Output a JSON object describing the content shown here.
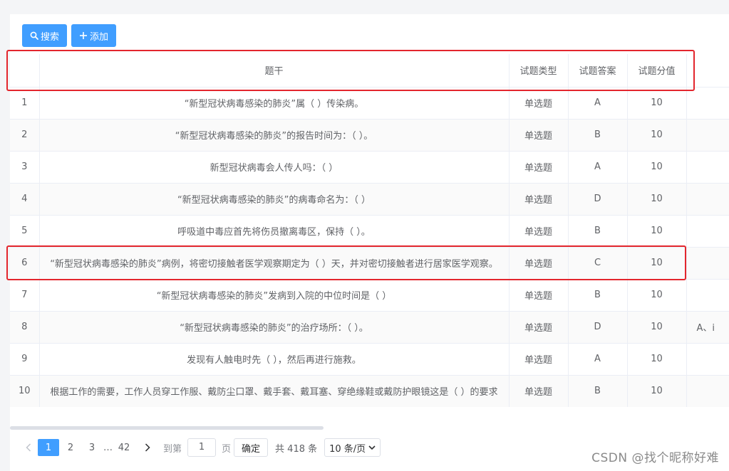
{
  "toolbar": {
    "search_label": "搜索",
    "add_label": "添加",
    "search_icon": "search-icon",
    "add_icon": "plus-icon"
  },
  "table": {
    "columns": [
      "",
      "题干",
      "试题类型",
      "试题答案",
      "试题分值",
      ""
    ],
    "rows": [
      {
        "index": "1",
        "question": "“新型冠状病毒感染的肺炎”属（  ）传染病。",
        "type": "单选题",
        "answer": "A",
        "score": "10",
        "extra": ""
      },
      {
        "index": "2",
        "question": "“新型冠状病毒感染的肺炎”的报告时间为：（   ）。",
        "type": "单选题",
        "answer": "B",
        "score": "10",
        "extra": ""
      },
      {
        "index": "3",
        "question": "新型冠状病毒会人传人吗：（   ）",
        "type": "单选题",
        "answer": "A",
        "score": "10",
        "extra": ""
      },
      {
        "index": "4",
        "question": "“新型冠状病毒感染的肺炎”的病毒命名为：（   ）",
        "type": "单选题",
        "answer": "D",
        "score": "10",
        "extra": ""
      },
      {
        "index": "5",
        "question": "呼吸道中毒应首先将伤员撤离毒区，保持（   ）。",
        "type": "单选题",
        "answer": "B",
        "score": "10",
        "extra": ""
      },
      {
        "index": "6",
        "question": "“新型冠状病毒感染的肺炎”病例，将密切接触者医学观察期定为（  ）天，并对密切接触者进行居家医学观察。",
        "type": "单选题",
        "answer": "C",
        "score": "10",
        "extra": ""
      },
      {
        "index": "7",
        "question": "“新型冠状病毒感染的肺炎”发病到入院的中位时间是（   ）",
        "type": "单选题",
        "answer": "B",
        "score": "10",
        "extra": ""
      },
      {
        "index": "8",
        "question": "“新型冠状病毒感染的肺炎”的治疗场所：（   ）。",
        "type": "单选题",
        "answer": "D",
        "score": "10",
        "extra": "A、i"
      },
      {
        "index": "9",
        "question": "发现有人触电时先（   ），然后再进行施救。",
        "type": "单选题",
        "answer": "A",
        "score": "10",
        "extra": ""
      },
      {
        "index": "10",
        "question": "根据工作的需要，工作人员穿工作服、戴防尘口罩、戴手套、戴耳塞、穿绝缘鞋或戴防护眼镜这是（  ）的要求",
        "type": "单选题",
        "answer": "B",
        "score": "10",
        "extra": ""
      }
    ]
  },
  "pagination": {
    "prev_icon": "chevron-left-icon",
    "next_icon": "chevron-right-icon",
    "pages": [
      "1",
      "2",
      "3",
      "…",
      "42"
    ],
    "active_page": "1",
    "goto_prefix": "到第",
    "goto_value": "1",
    "goto_suffix": "页",
    "confirm_label": "确定",
    "total_text": "共 418 条",
    "page_size": "10 条/页"
  },
  "watermark": "CSDN @找个昵称好难",
  "colors": {
    "primary": "#409eff",
    "highlight": "#e3262d"
  }
}
